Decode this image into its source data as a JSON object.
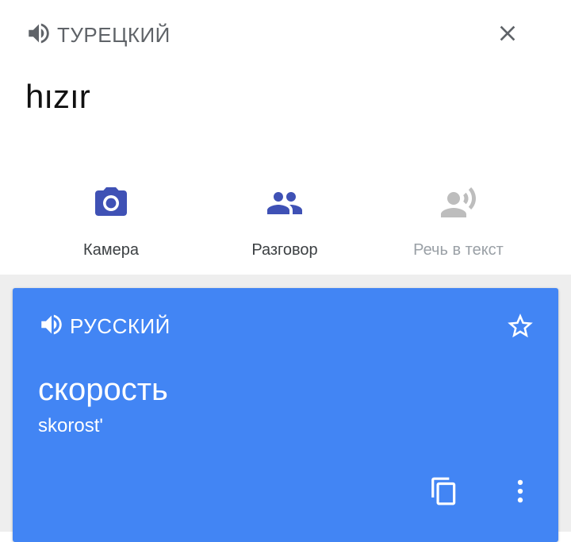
{
  "source": {
    "language_label": "ТУРЕЦКИЙ",
    "text": "hızır",
    "speaker_icon": "speaker-icon",
    "close_icon": "close-icon"
  },
  "actions": [
    {
      "label": "Камера",
      "icon": "camera-icon",
      "enabled": true
    },
    {
      "label": "Разговор",
      "icon": "conversation-icon",
      "enabled": true
    },
    {
      "label": "Речь в текст",
      "icon": "speech-to-text-icon",
      "enabled": false
    }
  ],
  "translation": {
    "language_label": "РУССКИЙ",
    "text": "скорость",
    "transliteration": "skorost'",
    "speaker_icon": "speaker-icon",
    "star_icon": "star-icon",
    "copy_icon": "copy-icon",
    "more_icon": "more-vert-icon"
  },
  "colors": {
    "accent_blue": "#4285f4",
    "icon_indigo": "#3f51b5",
    "text_gray": "#5f6368",
    "disabled_gray": "#9aa0a6"
  }
}
